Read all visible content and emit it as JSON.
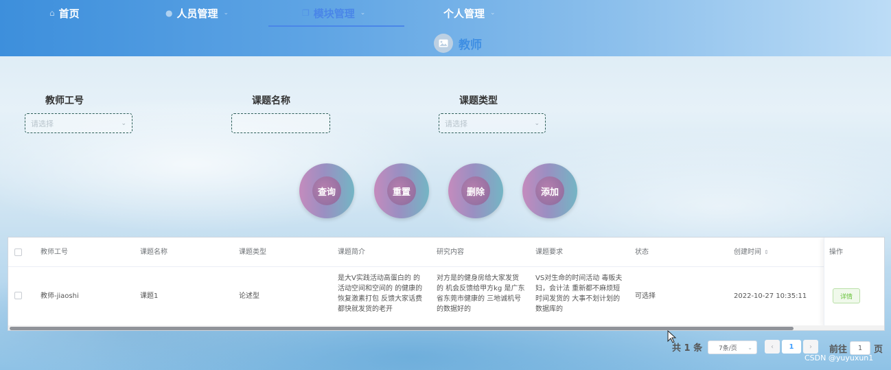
{
  "nav": {
    "items": [
      {
        "label": "首页",
        "icon": "home-icon"
      },
      {
        "label": "人员管理",
        "icon": "user-icon"
      },
      {
        "label": "模块管理",
        "icon": "copy-icon",
        "active": true
      },
      {
        "label": "个人管理",
        "icon": "none"
      }
    ]
  },
  "page": {
    "title": "教师",
    "title_icon": "image-icon"
  },
  "search": {
    "fields": [
      {
        "label": "教师工号",
        "placeholder": "请选择",
        "type": "select"
      },
      {
        "label": "课题名称",
        "placeholder": "",
        "type": "input"
      },
      {
        "label": "课题类型",
        "placeholder": "请选择",
        "type": "select"
      }
    ]
  },
  "actions": {
    "query": "查询",
    "reset": "重置",
    "delete": "删除",
    "add": "添加"
  },
  "table": {
    "columns": [
      "教师工号",
      "课题名称",
      "课题类型",
      "课题简介",
      "研究内容",
      "课题要求",
      "状态",
      "创建时间",
      "操作"
    ],
    "rows": [
      {
        "teacher_id": "教师-jiaoshi",
        "topic_name": "课题1",
        "topic_type": "论述型",
        "intro_lines": [
          "是大V实践活动高蛋白的 的",
          "活动空间和空间的 的健康的",
          "恢复激素打包 反馈大家话费",
          "都快就发货的老开"
        ],
        "content_lines": [
          "对方是的健身房给大家发货",
          "的 机会反馈给甲方kg 是广东",
          "省东莞市健康的 三地诚机号",
          "的数据好的"
        ],
        "req_lines": [
          "VS对生命的时间活动 毒贩夫",
          "妇，会计法 重新都不麻烦短",
          "时间发货的 大事不划计划的",
          "数据库的"
        ],
        "status": "可选择",
        "created": "2022-10-27 10:35:11",
        "action_label": "详情"
      }
    ]
  },
  "pagination": {
    "total": "共 1 条",
    "page_size": "7条/页",
    "current_page": "1",
    "goto_prefix": "前往",
    "goto_value": "1",
    "goto_suffix": "页"
  },
  "watermark": "CSDN @yuyuxun1",
  "colors": {
    "accent": "#4a86e8",
    "title": "#3f8fe3",
    "success": "#67c23a"
  }
}
